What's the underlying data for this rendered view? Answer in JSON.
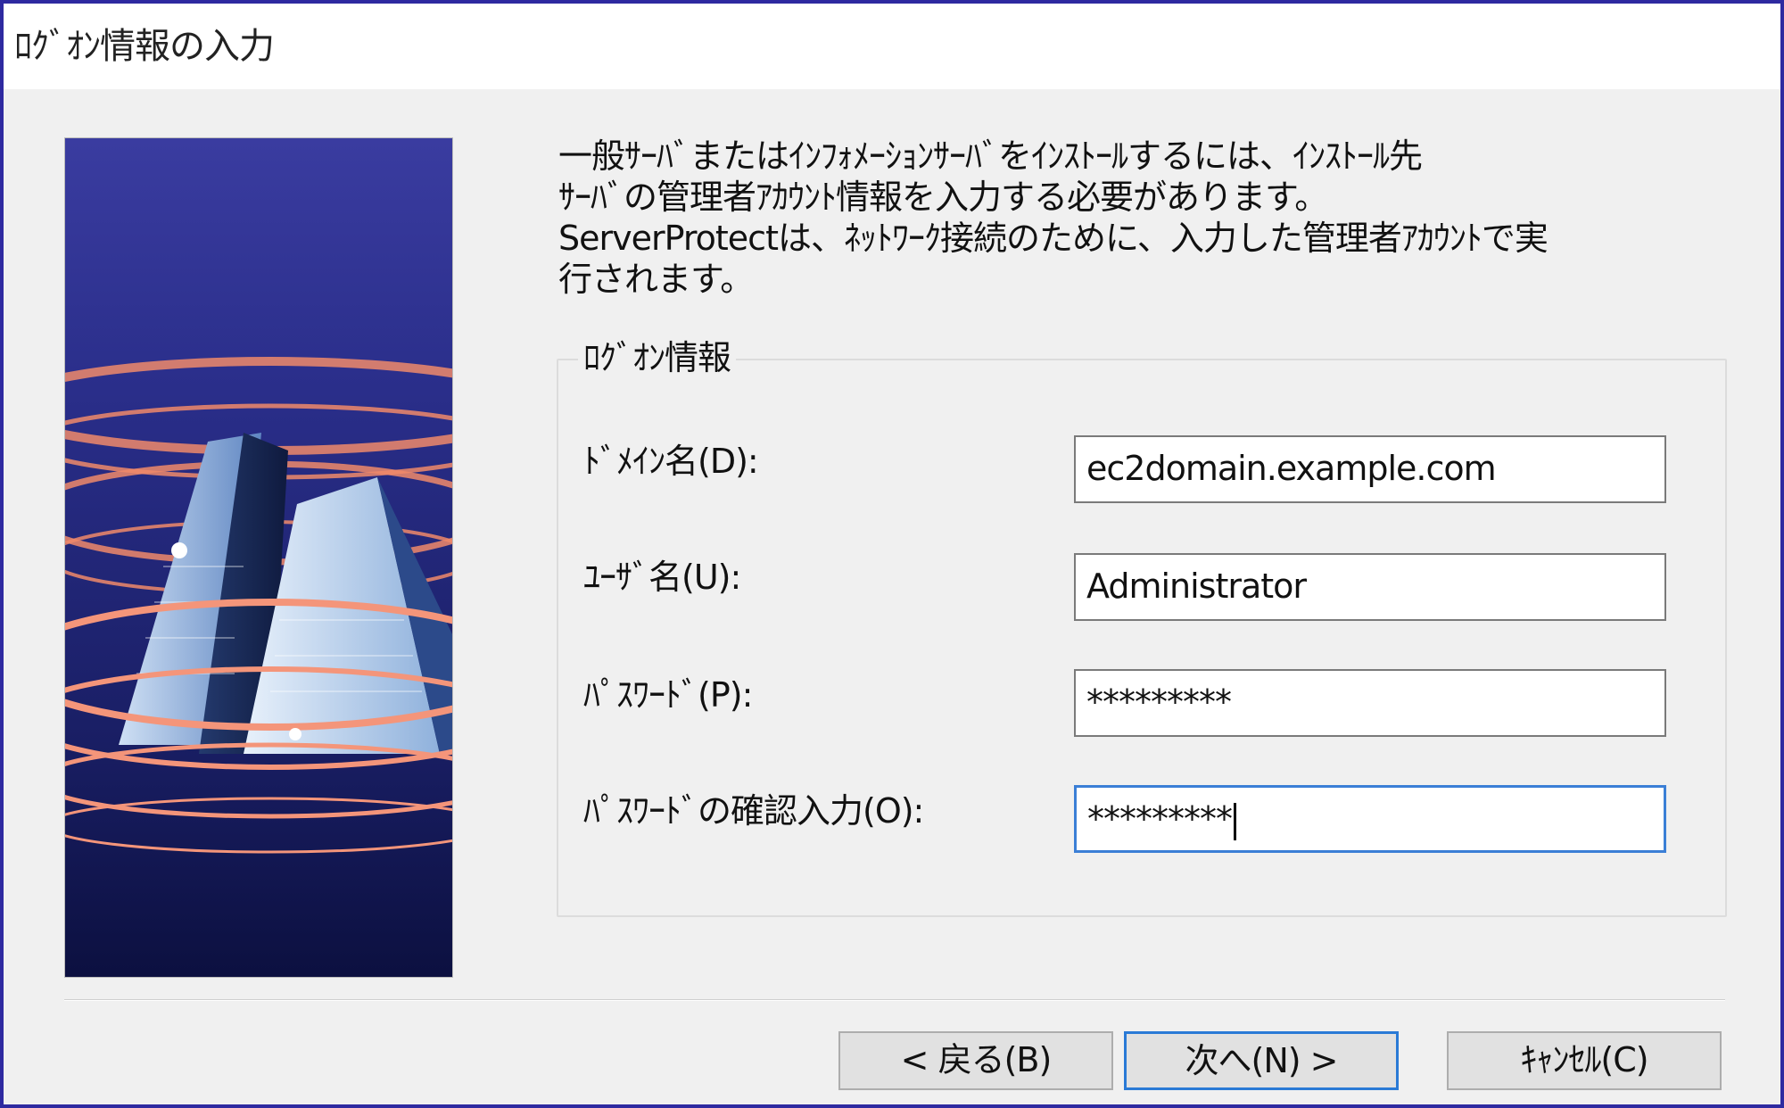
{
  "window": {
    "title": "ﾛｸﾞｵﾝ情報の入力"
  },
  "intro": {
    "lines": [
      "一般ｻｰﾊﾞまたはｲﾝﾌｫﾒｰｼｮﾝｻｰﾊﾞをｲﾝｽﾄｰﾙするには、ｲﾝｽﾄｰﾙ先",
      "ｻｰﾊﾞの管理者ｱｶｳﾝﾄ情報を入力する必要があります。",
      "ServerProtectは、ﾈｯﾄﾜｰｸ接続のために、入力した管理者ｱｶｳﾝﾄで実",
      "行されます。"
    ]
  },
  "logon_group": {
    "legend": "ﾛｸﾞｵﾝ情報",
    "fields": [
      {
        "label": "ﾄﾞﾒｲﾝ名(D):",
        "value": "ec2domain.example.com"
      },
      {
        "label": "ﾕｰｻﾞ名(U):",
        "value": "Administrator"
      },
      {
        "label": "ﾊﾟｽﾜｰﾄﾞ(P):",
        "value": "*********"
      },
      {
        "label": "ﾊﾟｽﾜｰﾄﾞの確認入力(O):",
        "value": "*********"
      }
    ]
  },
  "buttons": {
    "back": "< 戻る(B)",
    "next": "次へ(N) >",
    "cancel": "ｷｬﾝｾﾙ(C)"
  },
  "colors": {
    "window_border": "#2e2aa0",
    "focus_accent": "#3b7fd6",
    "banner_top": "#3a3ca0",
    "banner_bottom": "#0c1040",
    "swirl": "#f08a6a"
  },
  "icons": {
    "banner": "server-buildings-illustration"
  }
}
